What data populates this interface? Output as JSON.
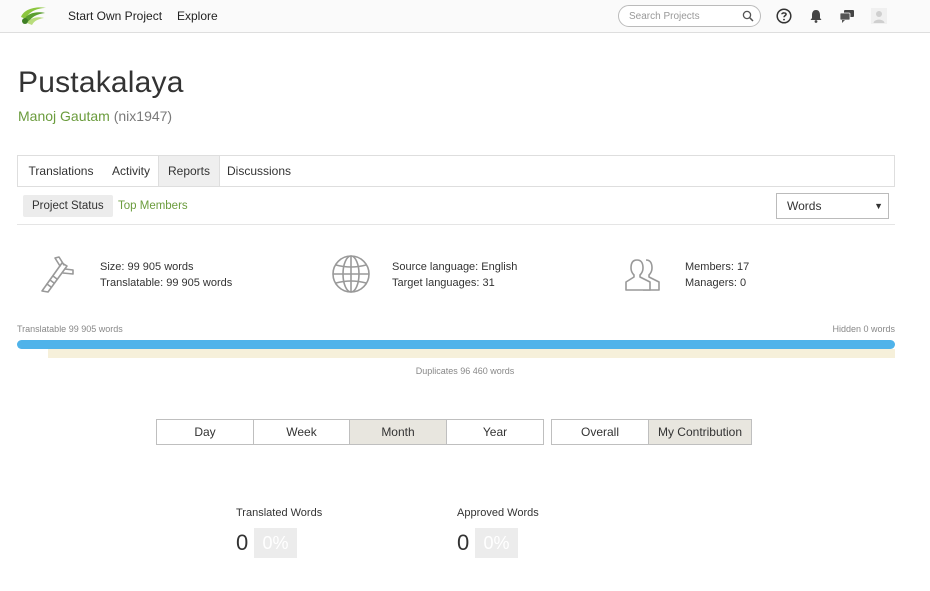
{
  "topbar": {
    "nav": [
      "Start Own Project",
      "Explore"
    ],
    "search_placeholder": "Search Projects",
    "icons": [
      "help-icon",
      "bell-icon",
      "chat-icon",
      "user-avatar-icon"
    ]
  },
  "project": {
    "title": "Pustakalaya",
    "owner_name": "Manoj Gautam",
    "owner_handle": "(nix1947)"
  },
  "tabs": [
    "Translations",
    "Activity",
    "Reports",
    "Discussions"
  ],
  "active_tab": "Reports",
  "subnav": {
    "items": [
      "Project Status",
      "Top Members"
    ],
    "active": "Project Status",
    "unit_select": "Words"
  },
  "stats": {
    "size": "Size: 99 905 words",
    "translatable": "Translatable: 99 905 words",
    "source_language": "Source language: English",
    "target_languages": "Target languages: 31",
    "members": "Members: 17",
    "managers": "Managers: 0"
  },
  "progress": {
    "left_label": "Translatable 99 905 words",
    "right_label": "Hidden 0 words",
    "duplicates_label": "Duplicates 96 460 words",
    "translatable_fraction": 1.0,
    "duplicates_fraction": 0.965
  },
  "periods": [
    "Day",
    "Week",
    "Month",
    "Year"
  ],
  "active_period": "Month",
  "scopes": [
    "Overall",
    "My Contribution"
  ],
  "active_scope": "My Contribution",
  "metrics": {
    "translated_label": "Translated Words",
    "translated_value": "0",
    "translated_pct": "0%",
    "approved_label": "Approved Words",
    "approved_value": "0",
    "approved_pct": "0%"
  },
  "colors": {
    "accent_green": "#6b9c3d",
    "progress_blue": "#4fb3ea",
    "duplicates_beige": "#f6f0da"
  }
}
